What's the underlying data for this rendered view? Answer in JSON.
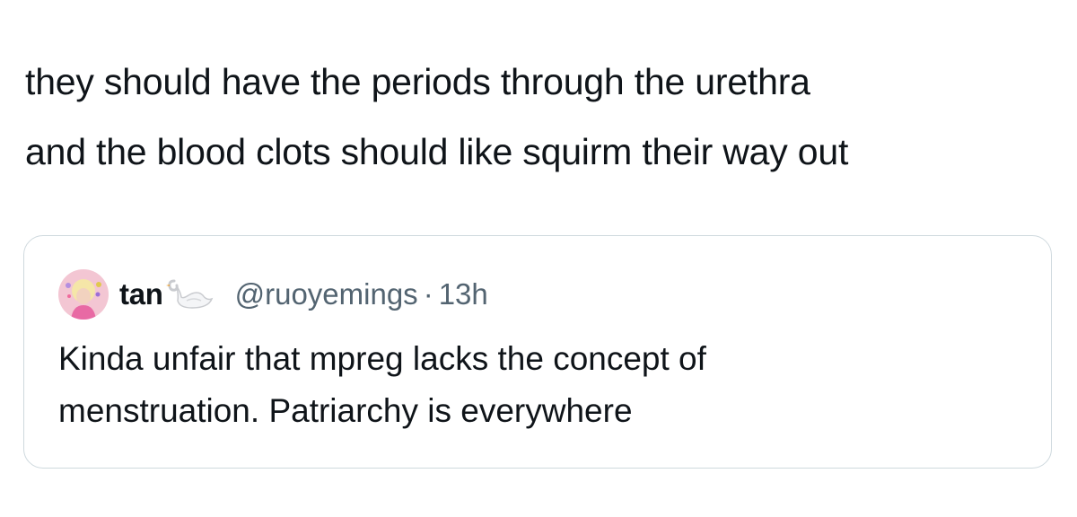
{
  "tweet": {
    "text_lines": [
      "they should have the periods through the urethra",
      "and the blood clots should like squirm their way out"
    ]
  },
  "quote": {
    "author": {
      "display_name": "tan",
      "name_icon": "swan-emoji-icon",
      "handle": "@ruoyemings",
      "separator": "·",
      "time": "13h",
      "avatar_icon": "avatar-photo"
    },
    "text_lines": [
      "Kinda unfair that mpreg lacks the concept of",
      "menstruation. Patriarchy is everywhere"
    ]
  },
  "colors": {
    "text": "#0f1419",
    "secondary_text": "#536471",
    "card_border": "#cfd9de",
    "avatar_bg": "#f3c6d3"
  }
}
